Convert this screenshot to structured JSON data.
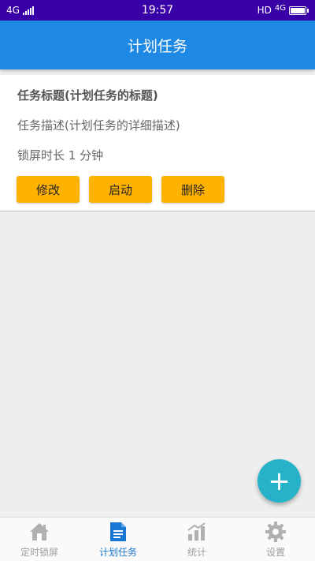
{
  "status_bar": {
    "network": "4G",
    "time": "19:57",
    "hd": "HD",
    "network_right": "4G"
  },
  "app_bar": {
    "title": "计划任务"
  },
  "task": {
    "title": "任务标题(计划任务的标题)",
    "description": "任务描述(计划任务的详细描述)",
    "lock_duration": "锁屏时长 1 分钟",
    "edit_label": "修改",
    "start_label": "启动",
    "delete_label": "删除"
  },
  "fab": {
    "label": "+"
  },
  "bottom_nav": {
    "items": [
      {
        "label": "定时锁屏",
        "icon": "home-icon"
      },
      {
        "label": "计划任务",
        "icon": "document-icon"
      },
      {
        "label": "统计",
        "icon": "chart-icon"
      },
      {
        "label": "设置",
        "icon": "gear-icon"
      }
    ],
    "active_index": 1
  },
  "colors": {
    "status_bar": "#3a00a8",
    "app_bar": "#1e88e5",
    "button": "#ffb300",
    "fab": "#26b3c9",
    "nav_active": "#1976d2",
    "nav_inactive": "#9e9e9e"
  }
}
